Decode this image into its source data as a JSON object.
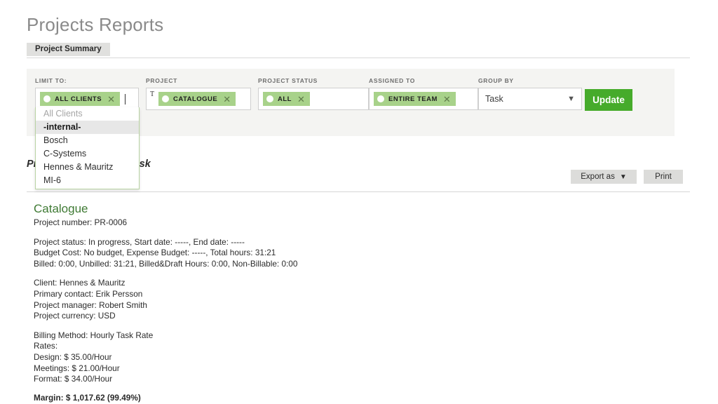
{
  "page": {
    "title": "Projects Reports"
  },
  "tabs": [
    {
      "label": "Project Summary",
      "active": true
    }
  ],
  "filters": {
    "limit_to": {
      "label": "LIMIT TO:",
      "tag": "ALL CLIENTS",
      "remove_icon": "close-icon",
      "typed_text": ""
    },
    "project": {
      "label": "PROJECT",
      "tag": "CATALOGUE",
      "typed_letter": "T",
      "remove_icon": "close-icon"
    },
    "project_status": {
      "label": "PROJECT STATUS",
      "tag": "ALL",
      "remove_icon": "close-icon"
    },
    "assigned_to": {
      "label": "ASSIGNED TO",
      "tag": "ENTIRE TEAM",
      "remove_icon": "close-icon"
    },
    "group_by": {
      "label": "GROUP BY",
      "value": "Task",
      "chevron": "⌄"
    },
    "update_label": "Update"
  },
  "dropdown": {
    "items": [
      {
        "label": "All Clients",
        "state": "placeholder"
      },
      {
        "label": "-internal-",
        "state": "selected"
      },
      {
        "label": "Bosch",
        "state": "normal"
      },
      {
        "label": "C-Systems",
        "state": "normal"
      },
      {
        "label": "Hennes & Mauritz",
        "state": "normal"
      },
      {
        "label": "MI-6",
        "state": "normal"
      }
    ]
  },
  "report_header": {
    "title": "Project Summary by Task",
    "export_label": "Export as",
    "export_chevron": "⌄",
    "print_label": "Print"
  },
  "report": {
    "project_name": "Catalogue",
    "project_number": "Project number: PR-0006",
    "status_line": "Project status: In progress, Start date: -----, End date: -----",
    "budget_line": "Budget Cost: No budget, Expense Budget: -----, Total hours: 31:21",
    "billed_line": "Billed: 0:00, Unbilled: 31:21, Billed&Draft Hours: 0:00, Non-Billable: 0:00",
    "client": "Client: Hennes & Mauritz",
    "primary_contact": "Primary contact: Erik Persson",
    "project_manager": "Project manager: Robert Smith",
    "project_currency": "Project currency: USD",
    "billing_method": "Billing Method: Hourly Task Rate",
    "rates_label": "Rates:",
    "rates": [
      "Design: $ 35.00/Hour",
      "Meetings: $ 21.00/Hour",
      "Format: $ 34.00/Hour"
    ],
    "margin": "Margin: $ 1,017.62 (99.49%)"
  },
  "colors": {
    "accent_green": "#46ab2b",
    "tag_green": "#a8d28a",
    "project_name_green": "#3f7a34",
    "filterbar_bg": "#f4f4f2",
    "tab_bg": "#e0e0de"
  }
}
